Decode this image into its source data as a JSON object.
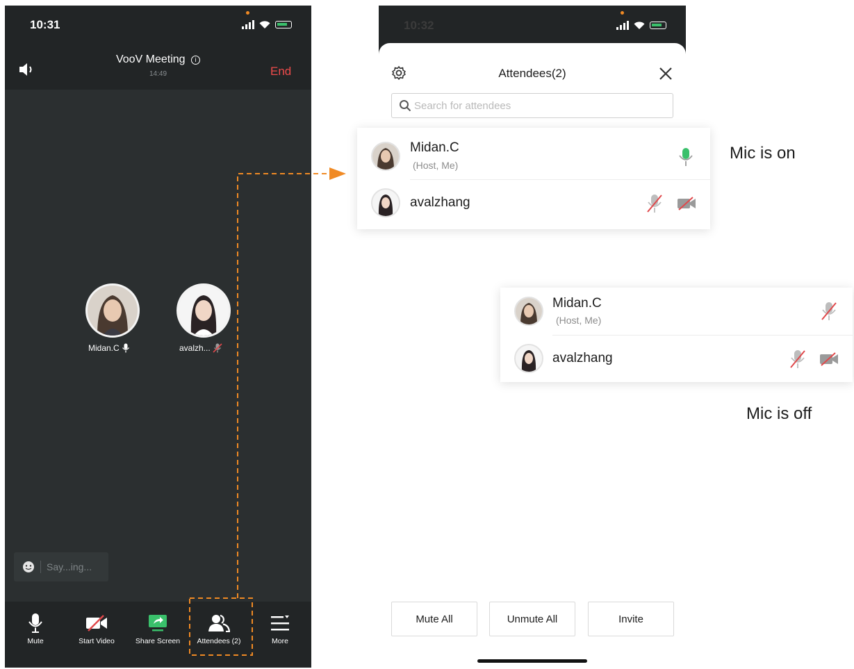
{
  "left_phone": {
    "status_time": "10:31",
    "app_title": "VooV Meeting",
    "duration": "14:49",
    "end_label": "End",
    "participants": [
      {
        "name": "Midan.C",
        "mic": "on"
      },
      {
        "name": "avalzh...",
        "mic": "off"
      }
    ],
    "chat_placeholder": "Say...ing...",
    "toolbar": [
      {
        "label": "Mute",
        "icon": "mic-icon"
      },
      {
        "label": "Start Video",
        "icon": "video-off-icon"
      },
      {
        "label": "Share Screen",
        "icon": "share-screen-icon"
      },
      {
        "label": "Attendees (2)",
        "icon": "attendees-icon"
      },
      {
        "label": "More",
        "icon": "more-icon"
      }
    ]
  },
  "right_phone": {
    "status_time": "10:32",
    "sheet_title": "Attendees(2)",
    "search_placeholder": "Search for attendees",
    "buttons": {
      "mute_all": "Mute All",
      "unmute_all": "Unmute All",
      "invite": "Invite"
    }
  },
  "callout_on": {
    "caption": "Mic is on",
    "rows": [
      {
        "name": "Midan.C",
        "sub": "(Host, Me)",
        "mic": "on"
      },
      {
        "name": "avalzhang",
        "sub": "",
        "mic": "off",
        "video": "off"
      }
    ]
  },
  "callout_off": {
    "caption": "Mic is off",
    "rows": [
      {
        "name": "Midan.C",
        "sub": "(Host, Me)",
        "mic": "off"
      },
      {
        "name": "avalzhang",
        "sub": "",
        "mic": "off",
        "video": "off"
      }
    ]
  },
  "colors": {
    "accent_orange": "#f08a24",
    "end_red": "#ef4b4b",
    "mic_green": "#3ac06b",
    "muted_red": "#e0484b"
  }
}
